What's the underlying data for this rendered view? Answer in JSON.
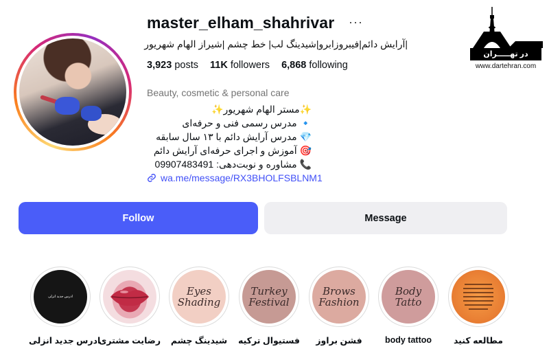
{
  "profile": {
    "username": "master_elham_shahrivar",
    "full_name": "|آرایش دائم|فیبروزابرو|شیدینگ لب| خط چشم |شیراز الهام شهریور",
    "category": "Beauty, cosmetic & personal care",
    "link": "wa.me/message/RX3BHOLFSBLNM1"
  },
  "stats": {
    "posts_count": "3,923",
    "posts_label": "posts",
    "followers_count": "11K",
    "followers_label": "followers",
    "following_count": "6,868",
    "following_label": "following"
  },
  "bio": [
    "✨مستر الهام شهریور✨",
    "🔹 مدرس رسمی فنی و حرفه‌ای",
    "💎 مدرس آرایش دائم با ۱۳ سال سابقه",
    "🎯 آموزش و اجرای حرفه‌ای آرایش دائم",
    "📞 مشاوره و نوبت‌دهی: 09907483491"
  ],
  "buttons": {
    "follow": "Follow",
    "message": "Message"
  },
  "more_icon": "···",
  "watermark": {
    "bar_text": "در تهـــــران",
    "url": "www.dartehran.com"
  },
  "highlights": [
    {
      "label": "ادرس جدید انزلی",
      "cover_text": "ادرس جدید انزلی"
    },
    {
      "label": "رضایت مشتری",
      "cover_text": ""
    },
    {
      "label": "شیدینگ چشم",
      "cover_text": "Eyes Shading"
    },
    {
      "label": "فستیوال ترکیه",
      "cover_text": "Turkey Festival"
    },
    {
      "label": "فشن براوز",
      "cover_text": "Brows Fashion"
    },
    {
      "label": "body tattoo",
      "cover_text": "Body Tatto"
    },
    {
      "label": "مطالعه کنید",
      "cover_text": ""
    }
  ],
  "colors": {
    "follow_button": "#4a5df9",
    "message_button": "#efeff2",
    "link": "#4150f7",
    "category": "#737373"
  }
}
